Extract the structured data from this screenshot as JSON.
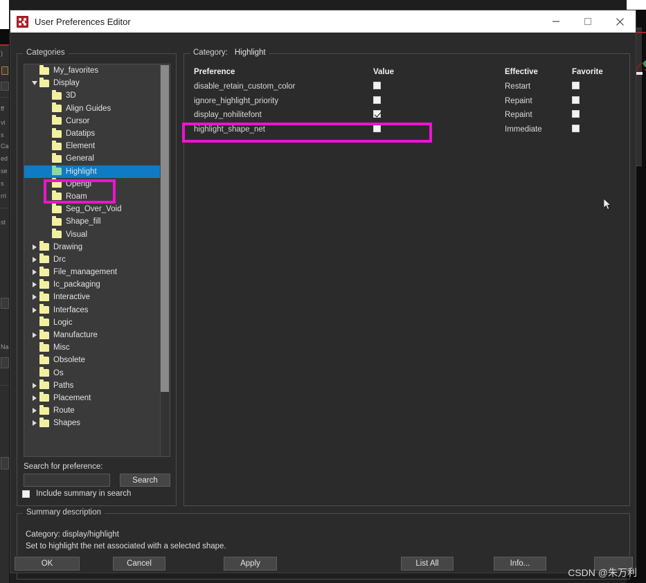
{
  "window": {
    "title": "User Preferences Editor",
    "icon": "app-dice-icon",
    "controls": {
      "minimize": "minimize-icon",
      "maximize": "maximize-icon",
      "close": "close-icon"
    }
  },
  "categories_panel": {
    "legend": "Categories",
    "tree": [
      {
        "label": "My_favorites",
        "depth": 1,
        "twisty": "none",
        "folder": "yellow",
        "selected": false
      },
      {
        "label": "Display",
        "depth": 1,
        "twisty": "expanded",
        "folder": "yellow",
        "selected": false
      },
      {
        "label": "3D",
        "depth": 2,
        "twisty": "none",
        "folder": "yellow",
        "selected": false
      },
      {
        "label": "Align Guides",
        "depth": 2,
        "twisty": "none",
        "folder": "yellow",
        "selected": false
      },
      {
        "label": "Cursor",
        "depth": 2,
        "twisty": "none",
        "folder": "yellow",
        "selected": false
      },
      {
        "label": "Datatips",
        "depth": 2,
        "twisty": "none",
        "folder": "yellow",
        "selected": false
      },
      {
        "label": "Element",
        "depth": 2,
        "twisty": "none",
        "folder": "yellow",
        "selected": false
      },
      {
        "label": "General",
        "depth": 2,
        "twisty": "none",
        "folder": "yellow",
        "selected": false
      },
      {
        "label": "Highlight",
        "depth": 2,
        "twisty": "none",
        "folder": "green",
        "selected": true
      },
      {
        "label": "Opengl",
        "depth": 2,
        "twisty": "none",
        "folder": "yellow",
        "selected": false
      },
      {
        "label": "Roam",
        "depth": 2,
        "twisty": "none",
        "folder": "yellow",
        "selected": false
      },
      {
        "label": "Seg_Over_Void",
        "depth": 2,
        "twisty": "none",
        "folder": "yellow",
        "selected": false
      },
      {
        "label": "Shape_fill",
        "depth": 2,
        "twisty": "none",
        "folder": "yellow",
        "selected": false
      },
      {
        "label": "Visual",
        "depth": 2,
        "twisty": "none",
        "folder": "yellow",
        "selected": false
      },
      {
        "label": "Drawing",
        "depth": 1,
        "twisty": "collapsed",
        "folder": "yellow",
        "selected": false
      },
      {
        "label": "Drc",
        "depth": 1,
        "twisty": "collapsed",
        "folder": "yellow",
        "selected": false
      },
      {
        "label": "File_management",
        "depth": 1,
        "twisty": "collapsed",
        "folder": "yellow",
        "selected": false
      },
      {
        "label": "Ic_packaging",
        "depth": 1,
        "twisty": "collapsed",
        "folder": "yellow",
        "selected": false
      },
      {
        "label": "Interactive",
        "depth": 1,
        "twisty": "collapsed",
        "folder": "yellow",
        "selected": false
      },
      {
        "label": "Interfaces",
        "depth": 1,
        "twisty": "collapsed",
        "folder": "yellow",
        "selected": false
      },
      {
        "label": "Logic",
        "depth": 1,
        "twisty": "none",
        "folder": "yellow",
        "selected": false
      },
      {
        "label": "Manufacture",
        "depth": 1,
        "twisty": "collapsed",
        "folder": "yellow",
        "selected": false
      },
      {
        "label": "Misc",
        "depth": 1,
        "twisty": "none",
        "folder": "yellow",
        "selected": false
      },
      {
        "label": "Obsolete",
        "depth": 1,
        "twisty": "none",
        "folder": "yellow",
        "selected": false
      },
      {
        "label": "Os",
        "depth": 1,
        "twisty": "none",
        "folder": "yellow",
        "selected": false
      },
      {
        "label": "Paths",
        "depth": 1,
        "twisty": "collapsed",
        "folder": "yellow",
        "selected": false
      },
      {
        "label": "Placement",
        "depth": 1,
        "twisty": "collapsed",
        "folder": "yellow",
        "selected": false
      },
      {
        "label": "Route",
        "depth": 1,
        "twisty": "collapsed",
        "folder": "yellow",
        "selected": false
      },
      {
        "label": "Shapes",
        "depth": 1,
        "twisty": "collapsed",
        "folder": "yellow",
        "selected": false
      }
    ],
    "search": {
      "label": "Search for preference:",
      "value": "",
      "placeholder": "",
      "button": "Search"
    },
    "include_summary": {
      "label": "Include summary in search",
      "checked": false
    }
  },
  "detail_panel": {
    "legend_prefix": "Category:",
    "legend_value": "Highlight",
    "columns": {
      "preference": "Preference",
      "value": "Value",
      "effective": "Effective",
      "favorite": "Favorite"
    },
    "rows": [
      {
        "preference": "disable_retain_custom_color",
        "value_checked": false,
        "effective": "Restart",
        "favorite_checked": false
      },
      {
        "preference": "ignore_highlight_priority",
        "value_checked": false,
        "effective": "Repaint",
        "favorite_checked": false
      },
      {
        "preference": "display_nohilitefont",
        "value_checked": true,
        "effective": "Repaint",
        "favorite_checked": false
      },
      {
        "preference": "highlight_shape_net",
        "value_checked": false,
        "effective": "Immediate",
        "favorite_checked": false
      }
    ]
  },
  "summary_panel": {
    "legend": "Summary description",
    "line1": "Category: display/highlight",
    "line2": "Set to highlight the net associated with a selected shape."
  },
  "buttons": {
    "ok": "OK",
    "cancel": "Cancel",
    "apply": "Apply",
    "list_all": "List All",
    "info": "Info...",
    "blank": ""
  },
  "watermark": "CSDN @朱万利",
  "annotations": {
    "highlight_color": "#f012d0",
    "tree_box_target": "Highlight",
    "row_box_target": "display_nohilitefont"
  },
  "colors": {
    "selection_blue": "#0f7bc4",
    "dialog_bg": "#2b2b2b",
    "panel_bg": "#3a3a3a",
    "titlebar_bg": "#ffffff",
    "folder_yellow": "#f2f0a0",
    "folder_green": "#8fd6a6"
  }
}
